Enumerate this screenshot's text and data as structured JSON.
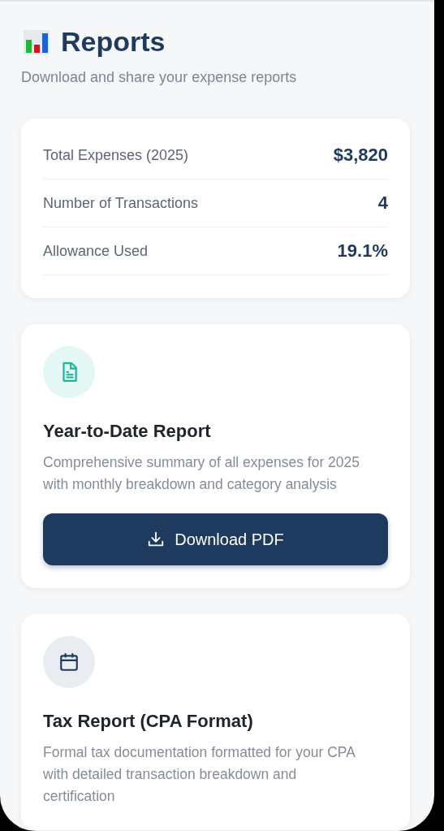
{
  "header": {
    "title": "Reports",
    "subtitle": "Download and share your expense reports"
  },
  "summary": [
    {
      "label": "Total Expenses (2025)",
      "value": "$3,820"
    },
    {
      "label": "Number of Transactions",
      "value": "4"
    },
    {
      "label": "Allowance Used",
      "value": "19.1%"
    }
  ],
  "reports": [
    {
      "kind": "document",
      "title": "Year-to-Date Report",
      "description": "Comprehensive summary of all expenses for 2025 with monthly breakdown and category analysis",
      "button": "Download PDF"
    },
    {
      "kind": "calendar",
      "title": "Tax Report (CPA Format)",
      "description": "Formal tax documentation formatted for your CPA with detailed transaction breakdown and certification"
    }
  ]
}
